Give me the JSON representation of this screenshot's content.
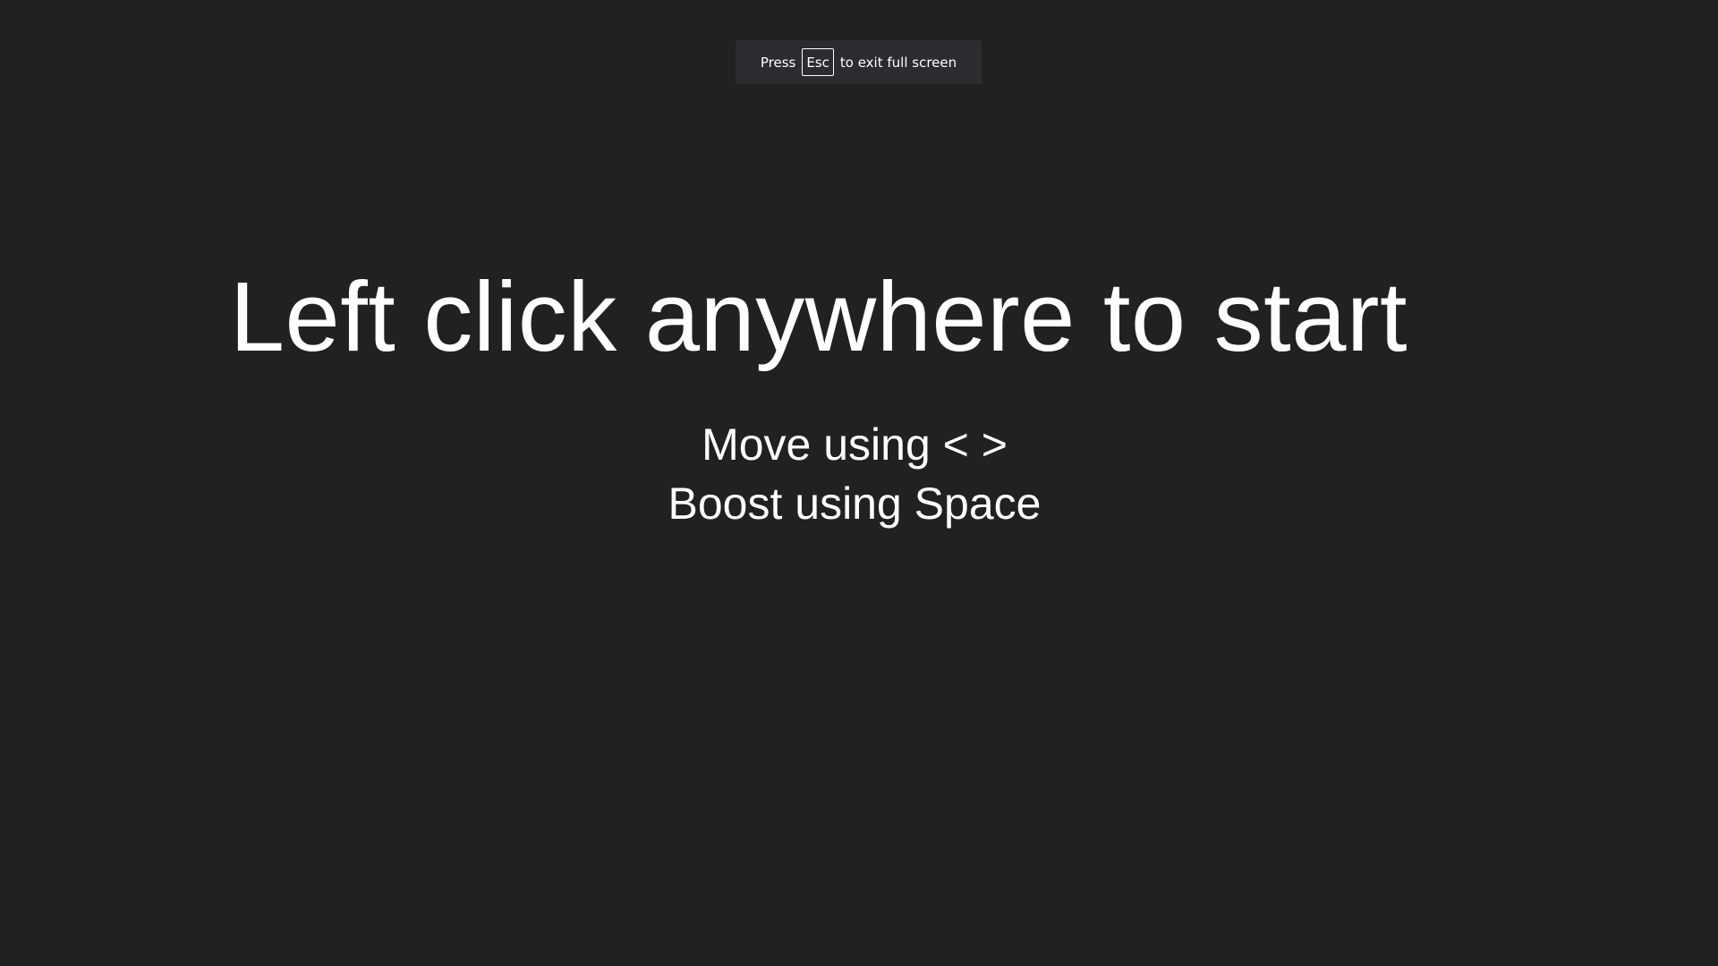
{
  "notice": {
    "prefix": "Press",
    "key": "Esc",
    "suffix": "to exit full screen"
  },
  "game": {
    "start_prompt": "Left click anywhere to start",
    "controls": {
      "move": "Move using < >",
      "boost": "Boost using Space"
    }
  },
  "colors": {
    "background": "#212121",
    "text": "#ffffff",
    "notice_bg": "#2a2c30"
  }
}
